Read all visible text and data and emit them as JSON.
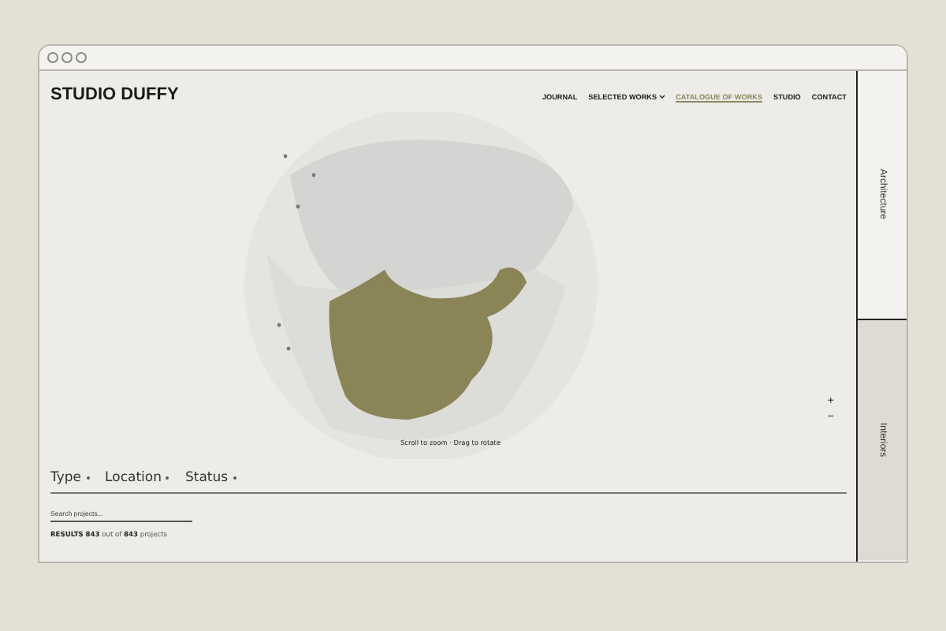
{
  "brand": "STUDIO DUFFY",
  "nav": [
    {
      "label": "JOURNAL",
      "selected": false,
      "dropdown": false
    },
    {
      "label": "SELECTED WORKS",
      "selected": false,
      "dropdown": true
    },
    {
      "label": "CATALOGUE OF WORKS",
      "selected": true,
      "dropdown": false
    },
    {
      "label": "STUDIO",
      "selected": false,
      "dropdown": false
    },
    {
      "label": "CONTACT",
      "selected": false,
      "dropdown": false
    }
  ],
  "map": {
    "hint": "Scroll to zoom · Drag to rotate",
    "zoom_in": "+",
    "zoom_out": "−"
  },
  "filters": [
    {
      "label": "Type"
    },
    {
      "label": "Location"
    },
    {
      "label": "Status"
    }
  ],
  "search": {
    "placeholder": "Search projects..."
  },
  "results": "**RESULTS**  **843** out of **843** projects",
  "side_tabs": [
    {
      "label": "Architecture",
      "selected": true
    },
    {
      "label": "Interiors",
      "selected": false
    }
  ]
}
